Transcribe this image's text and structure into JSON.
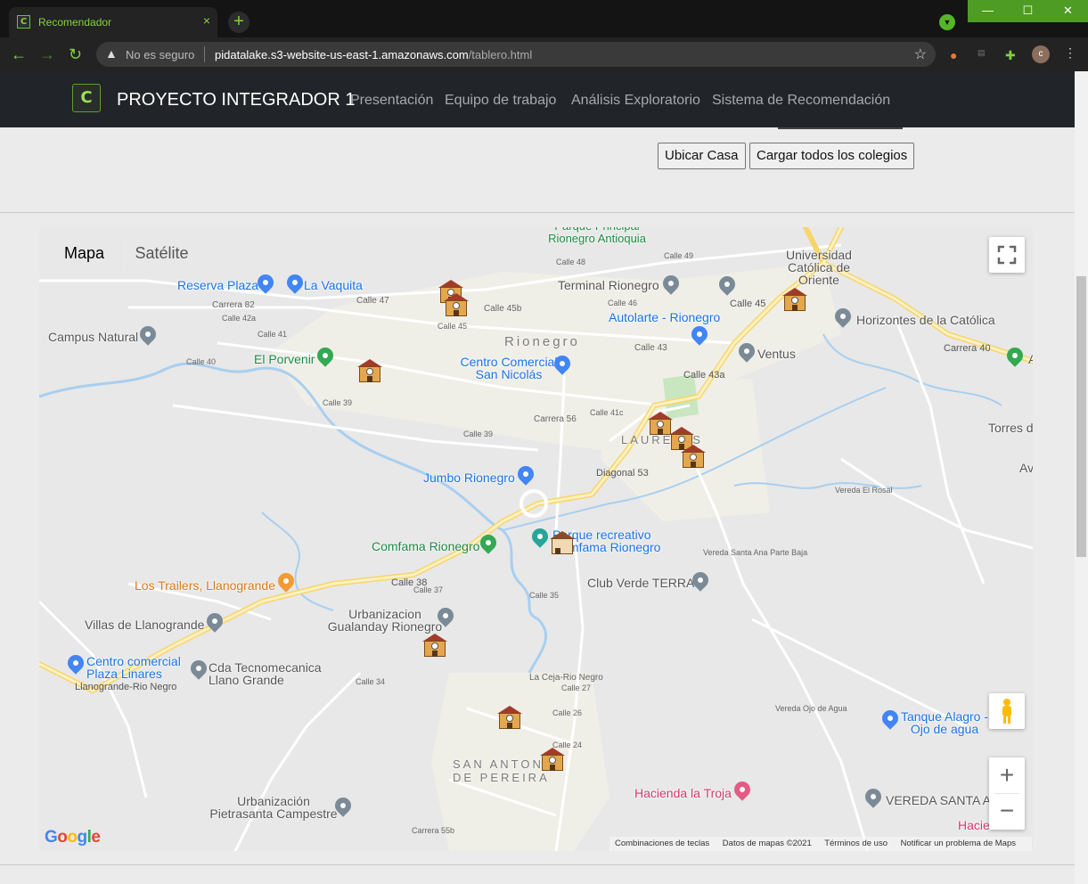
{
  "browser": {
    "tab_title": "Recomendador",
    "tab_close": "×",
    "new_tab": "+",
    "security_label": "No es seguro",
    "url_host": "pidatalake.s3-website-us-east-1.amazonaws.com",
    "url_path": "/tablero.html",
    "avatar_letter": "c",
    "window_min": "—",
    "window_max": "☐",
    "window_close": "✕"
  },
  "navbar": {
    "logo_text": "C",
    "brand": "PROYECTO INTEGRADOR 1",
    "links": [
      "Presentación",
      "Equipo de trabajo",
      "Análisis Exploratorio",
      "Sistema de Recomendación"
    ]
  },
  "actions": {
    "locate_house": "Ubicar Casa",
    "load_schools": "Cargar todos los colegios"
  },
  "map": {
    "type_map": "Mapa",
    "type_satellite": "Satélite",
    "zoom_in": "+",
    "zoom_out": "−",
    "google": "Google",
    "attribution": [
      "Combinaciones de teclas",
      "Datos de mapas ©2021",
      "Términos de uso",
      "Notificar un problema de Maps"
    ],
    "pois": [
      "Parque Principal Rionegro Antioquia",
      "Universidad Católica de Oriente",
      "Reserva Plaza",
      "La Vaquita",
      "Terminal Rionegro",
      "Autolarte - Rionegro",
      "Horizontes de la Católica",
      "Campus Natural",
      "El Porvenir",
      "Centro Comercial San Nicolás",
      "Ventus",
      "Torres d",
      "Jumbo Rionegro",
      "Parque recreativo Comfama Rionegro",
      "Comfama Rionegro",
      "Club Verde TERRA",
      "Los Trailers, Llanogrande",
      "Urbanizacion Gualanday Rionegro",
      "Villas de Llanogrande",
      "Centro comercial Plaza Linares",
      "Cda Tecnomecanica Llano Grande",
      "Tanque Alagro - Ojo de agua",
      "Hacienda la Troja",
      "VEREDA SANTA AI",
      "Urbanización Pietrasanta Campestre",
      "Hacie",
      "Av",
      "A"
    ],
    "cities": [
      "Rionegro",
      "LAURELES",
      "SAN ANTONIO DE PEREIRA"
    ],
    "streets": [
      "Calle 48",
      "Calle 49",
      "Calle 47",
      "Calle 45",
      "Calle 45b",
      "Carrera 82",
      "Calle 42a",
      "Calle 41",
      "Calle 40",
      "Calle 39",
      "Calle 43",
      "Calle 46",
      "Carrera 40",
      "Calle 43a",
      "Calle 45",
      "Calle 41c",
      "Calle 39",
      "Carrera 56",
      "Diagonal 53",
      "Calle 38",
      "Calle 37",
      "Calle 35",
      "Calle 34",
      "La Ceja-Rio Negro",
      "Llanogrande-Rio Negro",
      "Calle 27",
      "Calle 26",
      "Calle 24",
      "Carrera 55b",
      "Vereda Ojo de Agua",
      "Vereda Santa Ana Parte Baja",
      "Vereda El Rosal"
    ],
    "colors": {
      "land": "#e8e8e8",
      "road": "#ffffff",
      "highway": "#fce8a6",
      "water": "#aadaff",
      "urban": "#f1f0e8"
    }
  }
}
